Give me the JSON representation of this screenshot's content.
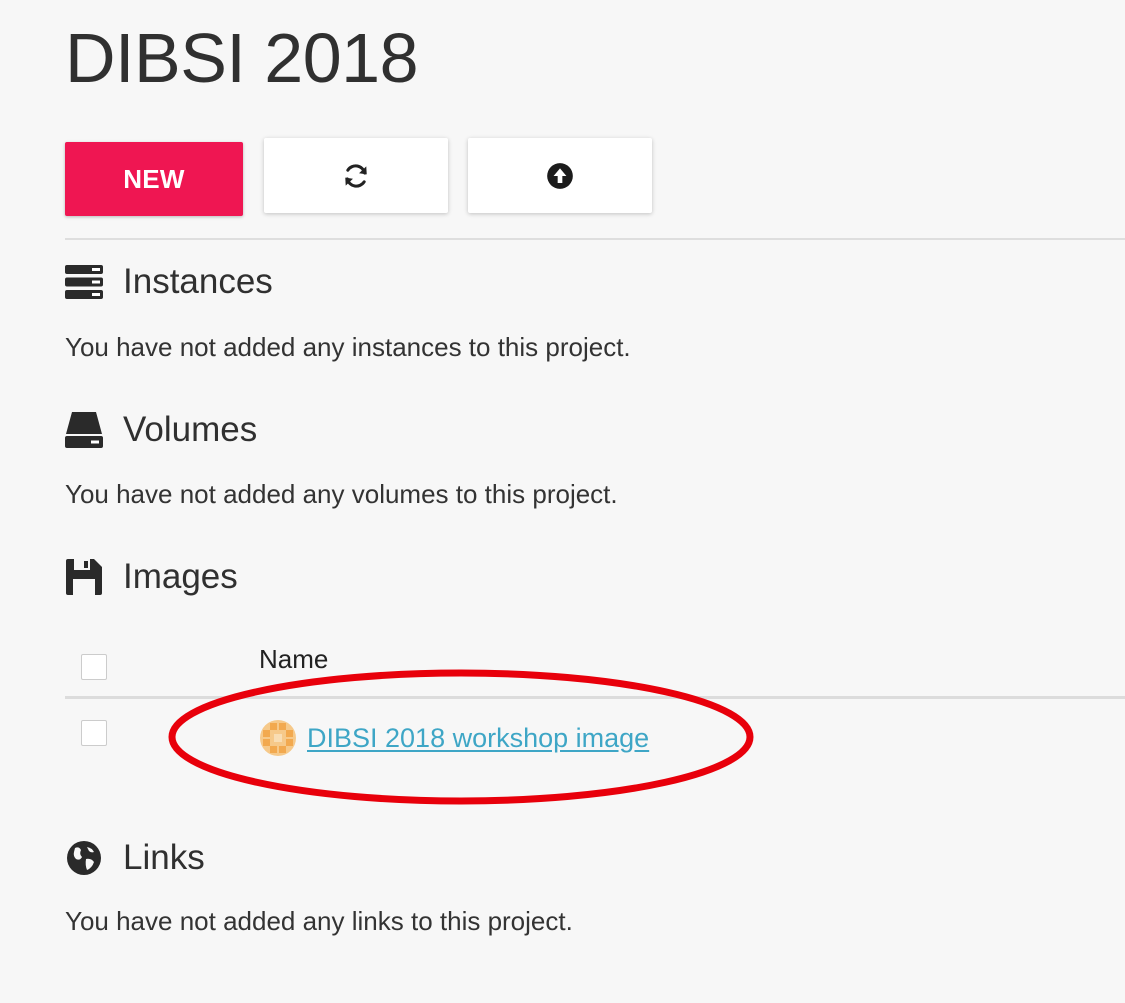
{
  "project": {
    "title": "DIBSI 2018"
  },
  "toolbar": {
    "new_label": "NEW",
    "new_color": "#ef1652",
    "refresh_icon": "refresh-icon",
    "upload_icon": "upload-icon"
  },
  "sections": {
    "instances": {
      "icon": "server-icon",
      "title": "Instances",
      "empty_text": "You have not added any instances to this project."
    },
    "volumes": {
      "icon": "hard-drive-icon",
      "title": "Volumes",
      "empty_text": "You have not added any volumes to this project."
    },
    "images": {
      "icon": "save-disk-icon",
      "title": "Images",
      "table": {
        "columns": [
          "Name"
        ],
        "rows": [
          {
            "name": "DIBSI 2018 workshop image",
            "icon": "image-identicon-icon"
          }
        ]
      }
    },
    "links": {
      "icon": "globe-icon",
      "title": "Links",
      "empty_text": "You have not added any links to this project."
    }
  },
  "annotation": {
    "highlight_color": "#e8000b"
  },
  "colors": {
    "link": "#3ea6c6",
    "background": "#f7f7f7"
  }
}
